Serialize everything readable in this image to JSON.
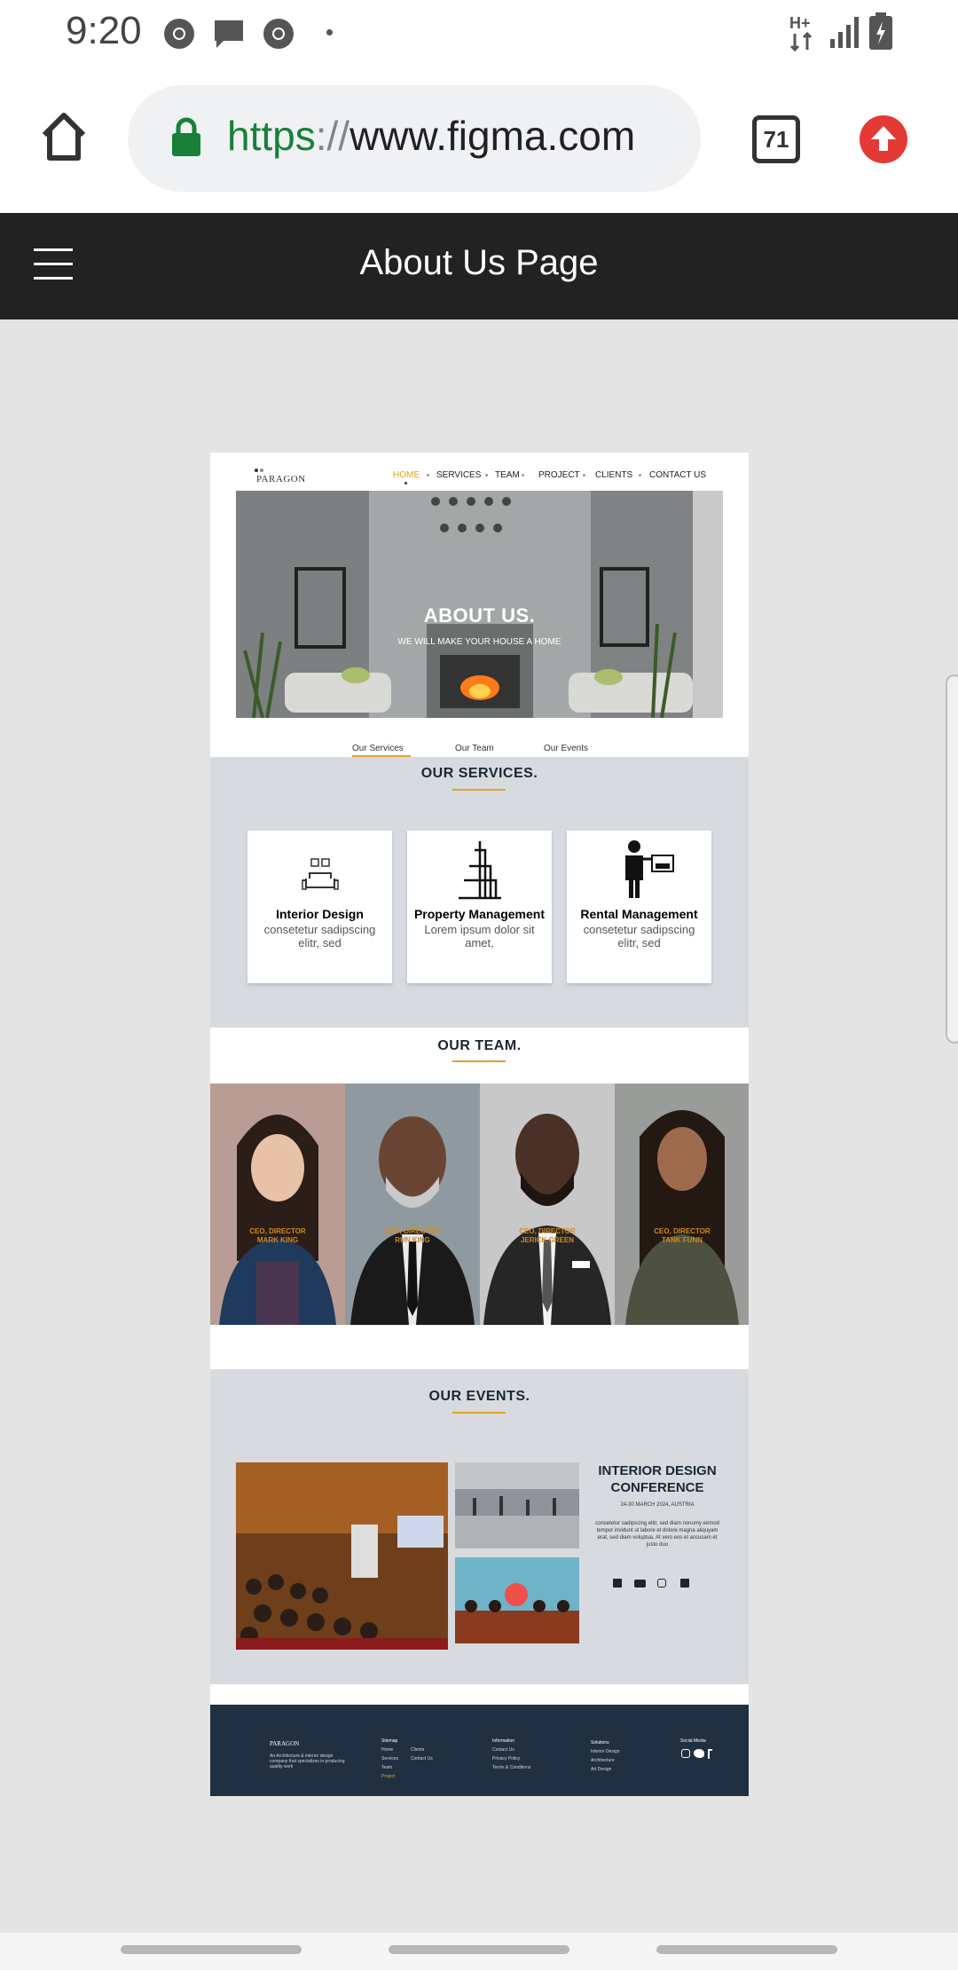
{
  "status_bar": {
    "time": "9:20",
    "icons": [
      "chrome-icon",
      "message-icon",
      "chrome-icon",
      "dot-icon",
      "data-arrows-icon",
      "signal-icon",
      "battery-icon"
    ],
    "network": "H+"
  },
  "browser": {
    "url_scheme": "https",
    "url_sep": "://",
    "url_host": "www.figma.com",
    "tab_count": "71"
  },
  "figma": {
    "title": "About Us Page"
  },
  "site": {
    "logo": "PARAGON",
    "nav": [
      "HOME",
      "SERVICES",
      "TEAM",
      "PROJECT",
      "CLIENTS",
      "CONTACT US"
    ],
    "hero_title": "ABOUT US.",
    "hero_subtitle": "WE WILL MAKE YOUR HOUSE A HOME",
    "tabs": [
      "Our Services",
      "Our Team",
      "Our Events"
    ],
    "services_title": "OUR SERVICES.",
    "services": [
      {
        "title": "Interior Design",
        "desc": "consetetur sadipscing elitr, sed"
      },
      {
        "title": "Property Management",
        "desc": "Lorem ipsum dolor sit amet,"
      },
      {
        "title": "Rental Management",
        "desc": "consetetur sadipscing elitr, sed"
      }
    ],
    "team_title": "OUR TEAM.",
    "team": [
      {
        "role": "CEO, DIRECTOR",
        "name": "MARK KING"
      },
      {
        "role": "CEO, DIRECTOR",
        "name": "RUN KING"
      },
      {
        "role": "CEO, DIRECTOR",
        "name": "JERICK GREEN"
      },
      {
        "role": "CEO, DIRECTOR",
        "name": "TANK FUNN"
      }
    ],
    "events_title": "OUR EVENTS.",
    "event": {
      "title_line1": "INTERIOR DESIGN",
      "title_line2": "CONFERENCE",
      "date": "24-30 MARCH 2024, AUSTRIA",
      "desc": "consetetur sadipscing elitr, sed diam nonumy eirmod tempor invidunt ut labore et dolore magna aliquyam erat, sed diam voluptua. At vero eos et accusam et justo duo"
    },
    "footer": {
      "logo": "PARAGON",
      "about": "An Architecture & interior design company that specializes in producing quality work",
      "sitemap_title": "Sitemap",
      "sitemap_col1": [
        "Home",
        "Services",
        "Team",
        "Project"
      ],
      "sitemap_col2": [
        "Clients",
        "Contact Us"
      ],
      "info_title": "Information",
      "info": [
        "Contact Us",
        "Privacy Policy",
        "Terms & Conditions"
      ],
      "solutions_title": "Solutions",
      "solutions": [
        "Interior Design",
        "Architecture",
        "Art Design"
      ],
      "social_title": "Social Media"
    }
  },
  "colors": {
    "accent": "#e3a227",
    "header_dark": "#222222",
    "footer": "#203040",
    "section_gray": "#d7dbdf",
    "secure_green": "#188038",
    "upgrade_red": "#e53935"
  }
}
